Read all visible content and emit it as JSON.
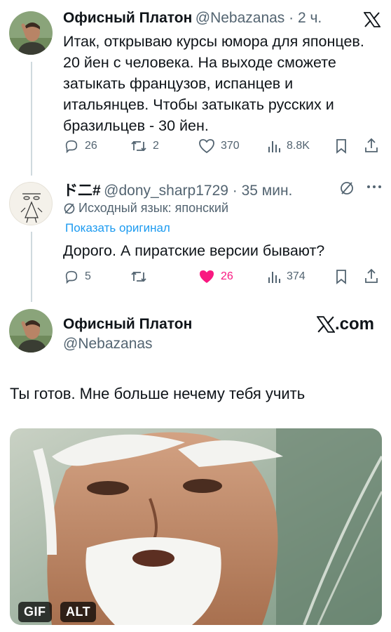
{
  "tweet1": {
    "display_name": "Офисный Платон",
    "handle_time": "@Nebazanas · 2 ч.",
    "text_lines": [
      "Итак, открываю курсы юмора для японцев.",
      "20 йен с человека. На выходе сможете",
      "затыкать французов, испанцев и",
      "итальянцев. Чтобы затыкать русских и",
      "бразильцев - 30 йен."
    ],
    "replies": "26",
    "retweets": "2",
    "likes": "370",
    "views": "8.8K"
  },
  "tweet2": {
    "display_name": "ド二#",
    "handle_time": "@dony_sharp1729 · 35 мин.",
    "source_lang": "Исходный язык: японский",
    "show_original": "Показать оригинал",
    "text": "Дорого. А пиратские версии бывают?",
    "replies": "5",
    "likes": "26",
    "views": "374",
    "like_color": "#f91880"
  },
  "tweet3": {
    "display_name": "Офисный Платон",
    "handle": "@Nebazanas",
    "site": ".com",
    "text": "Ты готов. Мне больше нечему тебя учить",
    "gif_badge": "GIF",
    "alt_badge": "ALT"
  },
  "colors": {
    "link": "#1d9bf0",
    "muted": "#536471",
    "text": "#0f1419"
  }
}
